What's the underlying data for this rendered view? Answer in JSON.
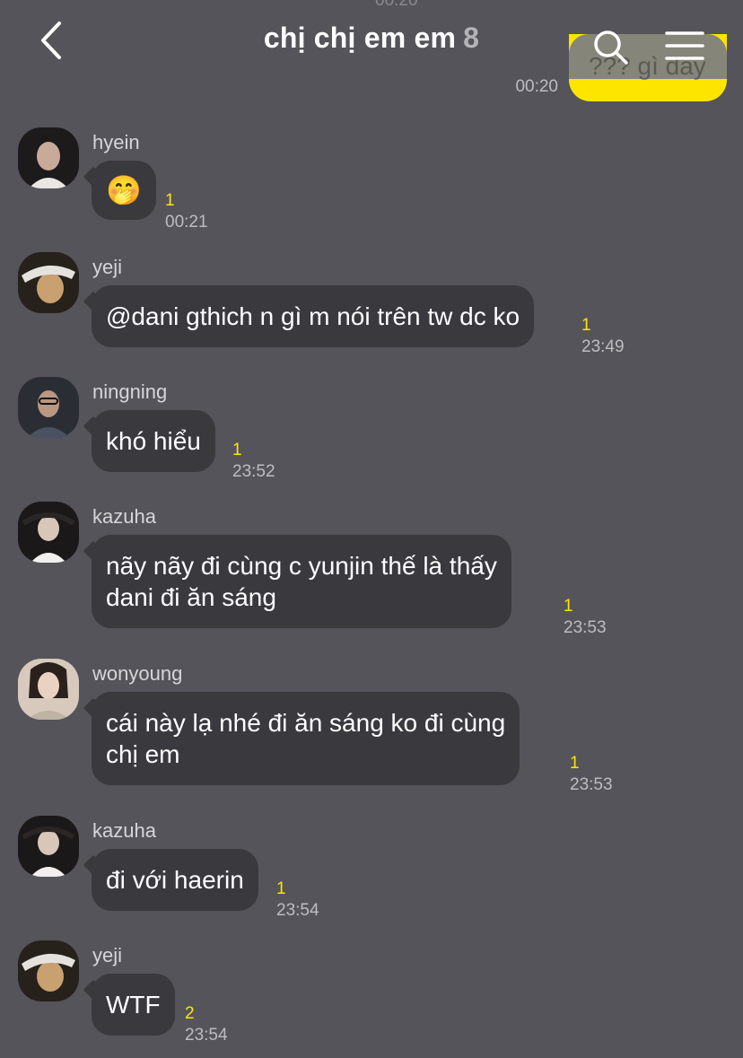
{
  "header": {
    "title": "chị chị em em",
    "member_count": "8"
  },
  "own_message": {
    "text": "??? gì đây",
    "time": "00:20"
  },
  "top_faded_time": "00:20",
  "messages": [
    {
      "sender": "hyein",
      "text": "🤭",
      "unread": "1",
      "time": "00:21",
      "avatar_colors": [
        "#1c1a1b",
        "#c9a99a"
      ]
    },
    {
      "sender": "yeji",
      "text": "@dani gthich n gì m nói trên tw dc ko",
      "unread": "1",
      "time": "23:49",
      "avatar_colors": [
        "#27211c",
        "#c9a070"
      ]
    },
    {
      "sender": "ningning",
      "text": "khó hiểu",
      "unread": "1",
      "time": "23:52",
      "avatar_colors": [
        "#2a2d33",
        "#b99782"
      ]
    },
    {
      "sender": "kazuha",
      "text_lines": [
        "nãy nãy đi cùng c yunjin thế là thấy",
        "dani đi ăn sáng"
      ],
      "unread": "1",
      "time": "23:53",
      "avatar_colors": [
        "#1a1818",
        "#d8c6b8"
      ]
    },
    {
      "sender": "wonyoung",
      "text_lines": [
        "cái này lạ nhé đi ăn sáng ko đi cùng",
        "chị em"
      ],
      "unread": "1",
      "time": "23:53",
      "avatar_colors": [
        "#d7c9bb",
        "#2b211c"
      ]
    },
    {
      "sender": "kazuha",
      "text": "đi với haerin",
      "unread": "1",
      "time": "23:54",
      "avatar_colors": [
        "#1a1818",
        "#d8c6b8"
      ]
    },
    {
      "sender": "yeji",
      "text": "WTF",
      "unread": "2",
      "time": "23:54",
      "avatar_colors": [
        "#27211c",
        "#c9a070"
      ]
    }
  ],
  "colors": {
    "background": "#55545a",
    "bubble": "#3a393e",
    "accent_yellow": "#fee500"
  }
}
